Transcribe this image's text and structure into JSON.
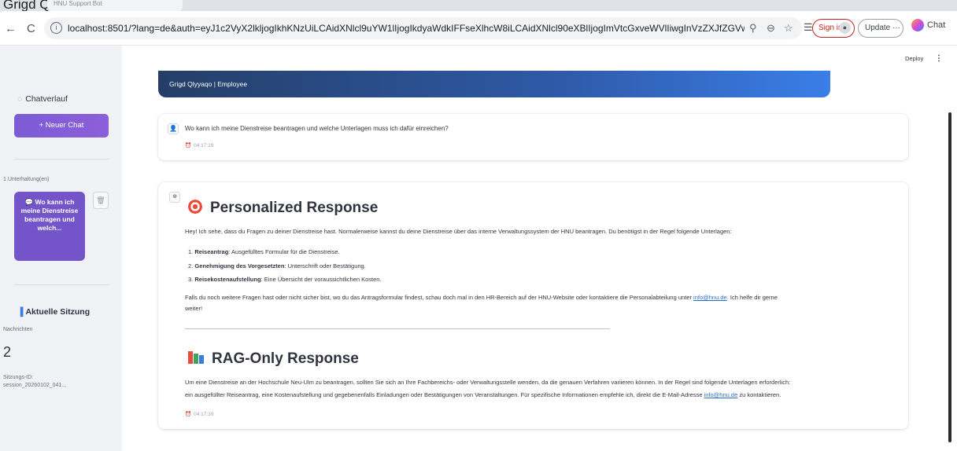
{
  "browser": {
    "tab_title": "Grigd Qlyyaqo",
    "tab_inactive_label": "HNU Support Bot",
    "url": "localhost:8501/?lang=de&auth=eyJ1c2VyX2lkljogIkhKNzUiLCAidXNlcl9uYW1lIjogIkdyaWdkIFFseXlhcW8iLCAidXNlcl90eXBlIjogImVtcGxveWVlIiwgInVzZXJfZGVwYXJ0bWV...",
    "signin_label": "Sign in",
    "update_label": "Update ···",
    "chat_label": "Chat"
  },
  "sidebar": {
    "history_title": "Chatverlauf",
    "new_chat_label": "+ Neuer Chat",
    "conversation_count": "1 Unterhaltung(en)",
    "conversation_item": "💬 Wo kann ich meine Dienstreise beantragen und welch...",
    "session_title": "Aktuelle Sitzung",
    "messages_label": "Nachrichten",
    "messages_value": "2",
    "session_id_label": "Sitzungs-ID:",
    "session_id_value": "session_20260102_041..."
  },
  "toolbar": {
    "deploy_label": "Deploy",
    "menu_label": "⋮"
  },
  "header": {
    "user_line": "Grigd Qlyyaqo | Employee"
  },
  "question": {
    "text": "Wo kann ich meine Dienstreise beantragen und welche Unterlagen muss ich dafür einreichen?",
    "time": "04:17:29"
  },
  "answer": {
    "personalized_title": "Personalized Response",
    "personalized_intro": "Hey! Ich sehe, dass du Fragen zu deiner Dienstreise hast. Normalerweise kannst du deine Dienstreise über das interne Verwaltungssystem der HNU beantragen. Du benötigst in der Regel folgende Unterlagen:",
    "list": [
      {
        "num": "1.",
        "bold": "Reiseantrag",
        "rest": ": Ausgefülltes Formular für die Dienstreise."
      },
      {
        "num": "2.",
        "bold": "Genehmigung des Vorgesetzten",
        "rest": ": Unterschrift oder Bestätigung."
      },
      {
        "num": "3.",
        "bold": "Reisekostenaufstellung",
        "rest": ": Eine Übersicht der voraussichtlichen Kosten."
      }
    ],
    "personalized_outro_a": "Falls du noch weitere Fragen hast oder nicht sicher bist, wo du das Antragsformular findest, schau doch mal in den HR-Bereich auf der HNU-Website oder kontaktiere die Personalabteilung unter ",
    "personalized_outro_link": "info@hnu.de",
    "personalized_outro_b": ". Ich helfe dir gerne",
    "personalized_outro_c": "weiter!",
    "rag_title": "RAG-Only Response",
    "rag_text_1": "Um eine Dienstreise an der Hochschule Neu-Ulm zu beantragen, sollten Sie sich an Ihre Fachbereichs- oder Verwaltungsstelle wenden, da die genauen Verfahren variieren können. In der Regel sind folgende Unterlagen erforderlich:",
    "rag_text_2a": "ein ausgefüllter Reiseantrag, eine Kostenaufstellung und gegebenenfalls Einladungen oder Bestätigungen von Veranstaltungen. Für spezifische Informationen empfehle ich, direkt die E-Mail-Adresse ",
    "rag_text_2_link": "info@hnu.de",
    "rag_text_2b": " zu kontaktieren.",
    "time": "04:17:39"
  },
  "colors": {
    "accent": "#7354c9",
    "banner_start": "#243e66",
    "banner_end": "#3a7ee8",
    "link": "#2b6cc4"
  }
}
